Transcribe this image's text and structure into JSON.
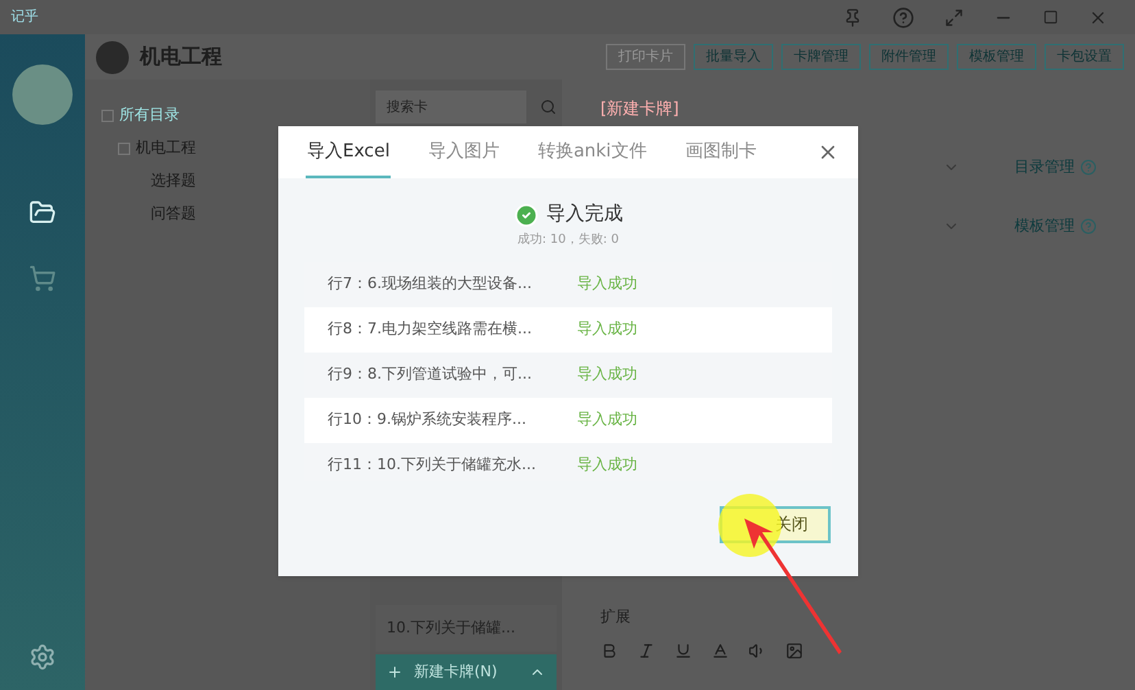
{
  "app": {
    "logo": "记乎",
    "title": "机电工程"
  },
  "toolbar": [
    {
      "label": "打印卡片",
      "disabled": true
    },
    {
      "label": "批量导入",
      "disabled": false
    },
    {
      "label": "卡牌管理",
      "disabled": false
    },
    {
      "label": "附件管理",
      "disabled": false
    },
    {
      "label": "模板管理",
      "disabled": false
    },
    {
      "label": "卡包设置",
      "disabled": false
    }
  ],
  "sidebar": {
    "items": [
      {
        "kind": "folder",
        "selected": true
      },
      {
        "kind": "cart",
        "selected": false
      }
    ]
  },
  "tree": [
    {
      "label": "所有目录",
      "selected": true,
      "children": [
        {
          "label": "机电工程",
          "selected": false,
          "children": [
            {
              "label": "选择题",
              "selected": false
            },
            {
              "label": "问答题",
              "selected": false
            }
          ]
        }
      ]
    }
  ],
  "search": {
    "placeholder": "搜索卡"
  },
  "cards": [
    "10.下列关于储罐..."
  ],
  "new_card_button": "新建卡牌(N)",
  "editor": {
    "heading": "[新建卡牌]",
    "links": [
      "目录管理",
      "模板管理"
    ],
    "extension_label": "扩展"
  },
  "dialog": {
    "tabs": [
      {
        "label": "导入Excel",
        "selected": true
      },
      {
        "label": "导入图片",
        "selected": false
      },
      {
        "label": "转换anki文件",
        "selected": false
      },
      {
        "label": "画图制卡",
        "selected": false
      }
    ],
    "status": "导入完成",
    "summary": "成功: 10，失败: 0",
    "rows": [
      {
        "name": "行7：6.现场组装的大型设备...",
        "result": "导入成功"
      },
      {
        "name": "行8：7.电力架空线路需在横...",
        "result": "导入成功"
      },
      {
        "name": "行9：8.下列管道试验中，可...",
        "result": "导入成功"
      },
      {
        "name": "行10：9.锅炉系统安装程序...",
        "result": "导入成功"
      },
      {
        "name": "行11：10.下列关于储罐充水...",
        "result": "导入成功"
      }
    ],
    "close_button": "关闭"
  }
}
